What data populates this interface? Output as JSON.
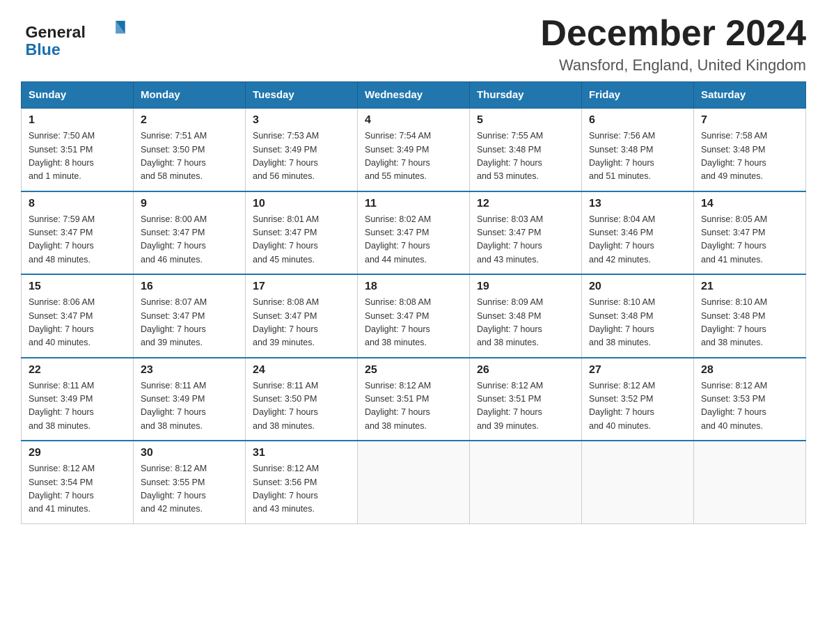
{
  "logo": {
    "line1": "General",
    "line2": "Blue",
    "alt": "GeneralBlue logo"
  },
  "title": {
    "month_year": "December 2024",
    "location": "Wansford, England, United Kingdom"
  },
  "weekdays": [
    "Sunday",
    "Monday",
    "Tuesday",
    "Wednesday",
    "Thursday",
    "Friday",
    "Saturday"
  ],
  "weeks": [
    [
      {
        "day": "1",
        "sunrise": "7:50 AM",
        "sunset": "3:51 PM",
        "daylight": "8 hours and 1 minute."
      },
      {
        "day": "2",
        "sunrise": "7:51 AM",
        "sunset": "3:50 PM",
        "daylight": "7 hours and 58 minutes."
      },
      {
        "day": "3",
        "sunrise": "7:53 AM",
        "sunset": "3:49 PM",
        "daylight": "7 hours and 56 minutes."
      },
      {
        "day": "4",
        "sunrise": "7:54 AM",
        "sunset": "3:49 PM",
        "daylight": "7 hours and 55 minutes."
      },
      {
        "day": "5",
        "sunrise": "7:55 AM",
        "sunset": "3:48 PM",
        "daylight": "7 hours and 53 minutes."
      },
      {
        "day": "6",
        "sunrise": "7:56 AM",
        "sunset": "3:48 PM",
        "daylight": "7 hours and 51 minutes."
      },
      {
        "day": "7",
        "sunrise": "7:58 AM",
        "sunset": "3:48 PM",
        "daylight": "7 hours and 49 minutes."
      }
    ],
    [
      {
        "day": "8",
        "sunrise": "7:59 AM",
        "sunset": "3:47 PM",
        "daylight": "7 hours and 48 minutes."
      },
      {
        "day": "9",
        "sunrise": "8:00 AM",
        "sunset": "3:47 PM",
        "daylight": "7 hours and 46 minutes."
      },
      {
        "day": "10",
        "sunrise": "8:01 AM",
        "sunset": "3:47 PM",
        "daylight": "7 hours and 45 minutes."
      },
      {
        "day": "11",
        "sunrise": "8:02 AM",
        "sunset": "3:47 PM",
        "daylight": "7 hours and 44 minutes."
      },
      {
        "day": "12",
        "sunrise": "8:03 AM",
        "sunset": "3:47 PM",
        "daylight": "7 hours and 43 minutes."
      },
      {
        "day": "13",
        "sunrise": "8:04 AM",
        "sunset": "3:46 PM",
        "daylight": "7 hours and 42 minutes."
      },
      {
        "day": "14",
        "sunrise": "8:05 AM",
        "sunset": "3:47 PM",
        "daylight": "7 hours and 41 minutes."
      }
    ],
    [
      {
        "day": "15",
        "sunrise": "8:06 AM",
        "sunset": "3:47 PM",
        "daylight": "7 hours and 40 minutes."
      },
      {
        "day": "16",
        "sunrise": "8:07 AM",
        "sunset": "3:47 PM",
        "daylight": "7 hours and 39 minutes."
      },
      {
        "day": "17",
        "sunrise": "8:08 AM",
        "sunset": "3:47 PM",
        "daylight": "7 hours and 39 minutes."
      },
      {
        "day": "18",
        "sunrise": "8:08 AM",
        "sunset": "3:47 PM",
        "daylight": "7 hours and 38 minutes."
      },
      {
        "day": "19",
        "sunrise": "8:09 AM",
        "sunset": "3:48 PM",
        "daylight": "7 hours and 38 minutes."
      },
      {
        "day": "20",
        "sunrise": "8:10 AM",
        "sunset": "3:48 PM",
        "daylight": "7 hours and 38 minutes."
      },
      {
        "day": "21",
        "sunrise": "8:10 AM",
        "sunset": "3:48 PM",
        "daylight": "7 hours and 38 minutes."
      }
    ],
    [
      {
        "day": "22",
        "sunrise": "8:11 AM",
        "sunset": "3:49 PM",
        "daylight": "7 hours and 38 minutes."
      },
      {
        "day": "23",
        "sunrise": "8:11 AM",
        "sunset": "3:49 PM",
        "daylight": "7 hours and 38 minutes."
      },
      {
        "day": "24",
        "sunrise": "8:11 AM",
        "sunset": "3:50 PM",
        "daylight": "7 hours and 38 minutes."
      },
      {
        "day": "25",
        "sunrise": "8:12 AM",
        "sunset": "3:51 PM",
        "daylight": "7 hours and 38 minutes."
      },
      {
        "day": "26",
        "sunrise": "8:12 AM",
        "sunset": "3:51 PM",
        "daylight": "7 hours and 39 minutes."
      },
      {
        "day": "27",
        "sunrise": "8:12 AM",
        "sunset": "3:52 PM",
        "daylight": "7 hours and 40 minutes."
      },
      {
        "day": "28",
        "sunrise": "8:12 AM",
        "sunset": "3:53 PM",
        "daylight": "7 hours and 40 minutes."
      }
    ],
    [
      {
        "day": "29",
        "sunrise": "8:12 AM",
        "sunset": "3:54 PM",
        "daylight": "7 hours and 41 minutes."
      },
      {
        "day": "30",
        "sunrise": "8:12 AM",
        "sunset": "3:55 PM",
        "daylight": "7 hours and 42 minutes."
      },
      {
        "day": "31",
        "sunrise": "8:12 AM",
        "sunset": "3:56 PM",
        "daylight": "7 hours and 43 minutes."
      },
      null,
      null,
      null,
      null
    ]
  ],
  "labels": {
    "sunrise": "Sunrise:",
    "sunset": "Sunset:",
    "daylight": "Daylight:"
  }
}
